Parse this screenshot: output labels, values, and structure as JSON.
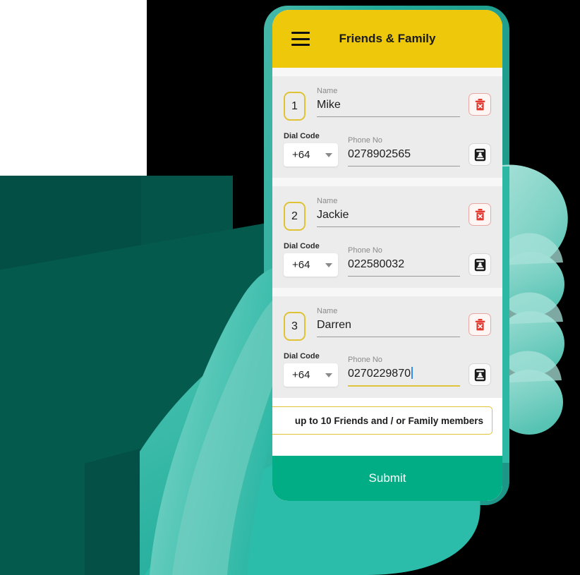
{
  "appbar": {
    "menu_icon": "hamburger-menu-icon",
    "title": "Friends & Family"
  },
  "contacts": [
    {
      "index": "1",
      "name_label": "Name",
      "name_value": "Mike",
      "dial_label": "Dial Code",
      "dial_value": "+64",
      "phone_label": "Phone No",
      "phone_value": "0278902565",
      "delete_icon": "trash-delete-icon",
      "contacts_icon": "contact-card-icon",
      "focused": false
    },
    {
      "index": "2",
      "name_label": "Name",
      "name_value": "Jackie",
      "dial_label": "Dial Code",
      "dial_value": "+64",
      "phone_label": "Phone No",
      "phone_value": "022580032",
      "delete_icon": "trash-delete-icon",
      "contacts_icon": "contact-card-icon",
      "focused": false
    },
    {
      "index": "3",
      "name_label": "Name",
      "name_value": "Darren",
      "dial_label": "Dial Code",
      "dial_value": "+64",
      "phone_label": "Phone No",
      "phone_value": "0270229870",
      "delete_icon": "trash-delete-icon",
      "contacts_icon": "contact-card-icon",
      "focused": true
    }
  ],
  "notice": {
    "text": "up to 10 Friends and / or Family members"
  },
  "submit": {
    "label": "Submit"
  },
  "colors": {
    "appbar_yellow": "#edc80b",
    "frame_teal": "#22aa99",
    "submit_green": "#00ad84",
    "badge_gold": "#e0c335",
    "delete_red": "#e23b32",
    "focus_caret_blue": "#2f8ef4",
    "background_dark_teal": "#034f45",
    "hand_teal": "#2bb9a6",
    "card_gray": "#ececec",
    "page_gray": "#f7f7f7"
  }
}
